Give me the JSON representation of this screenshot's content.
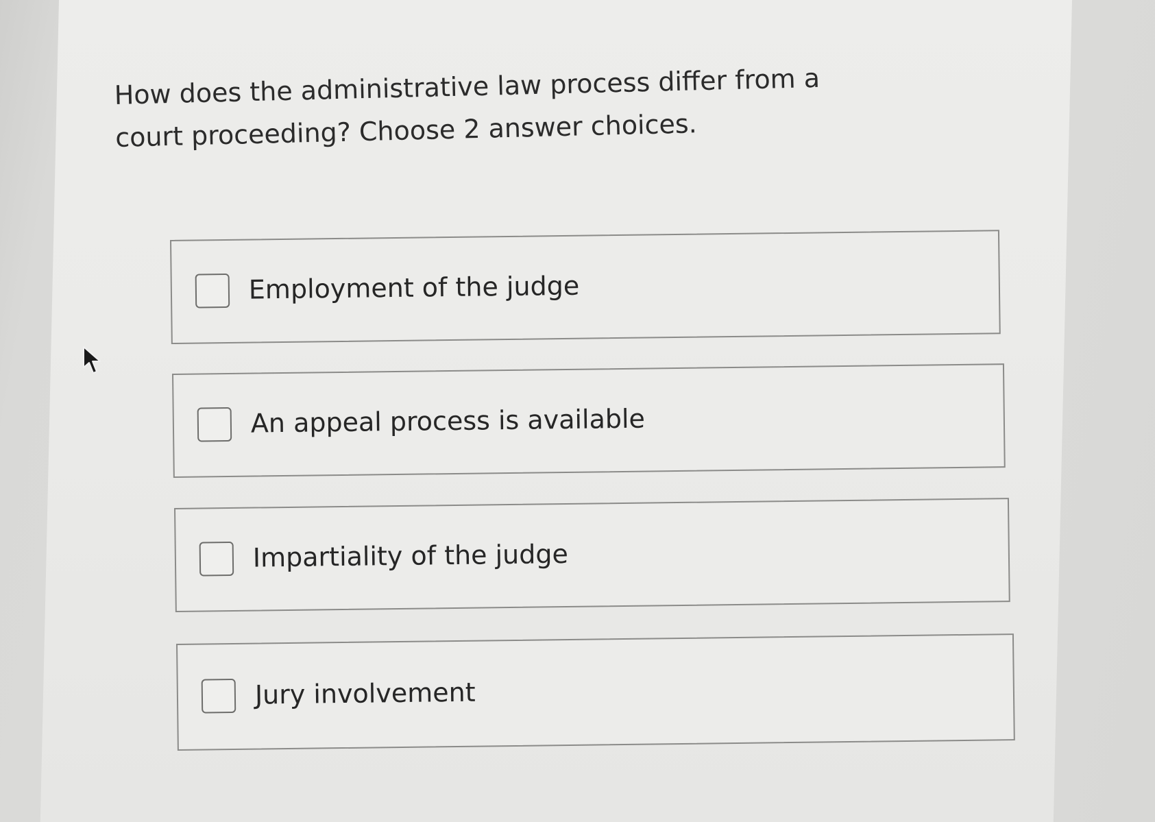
{
  "question": {
    "text": "How does the administrative law process differ from a court proceeding? Choose 2 answer choices."
  },
  "choices": [
    {
      "label": "Employment of the judge",
      "checked": false
    },
    {
      "label": "An appeal process is available",
      "checked": false
    },
    {
      "label": "Impartiality of the judge",
      "checked": false
    },
    {
      "label": "Jury involvement",
      "checked": false
    }
  ],
  "colors": {
    "panel": "#ebebe9",
    "border": "#8b8b89",
    "text": "#2b2b2b"
  },
  "icons": {
    "pointer": "mouse-pointer-icon"
  }
}
